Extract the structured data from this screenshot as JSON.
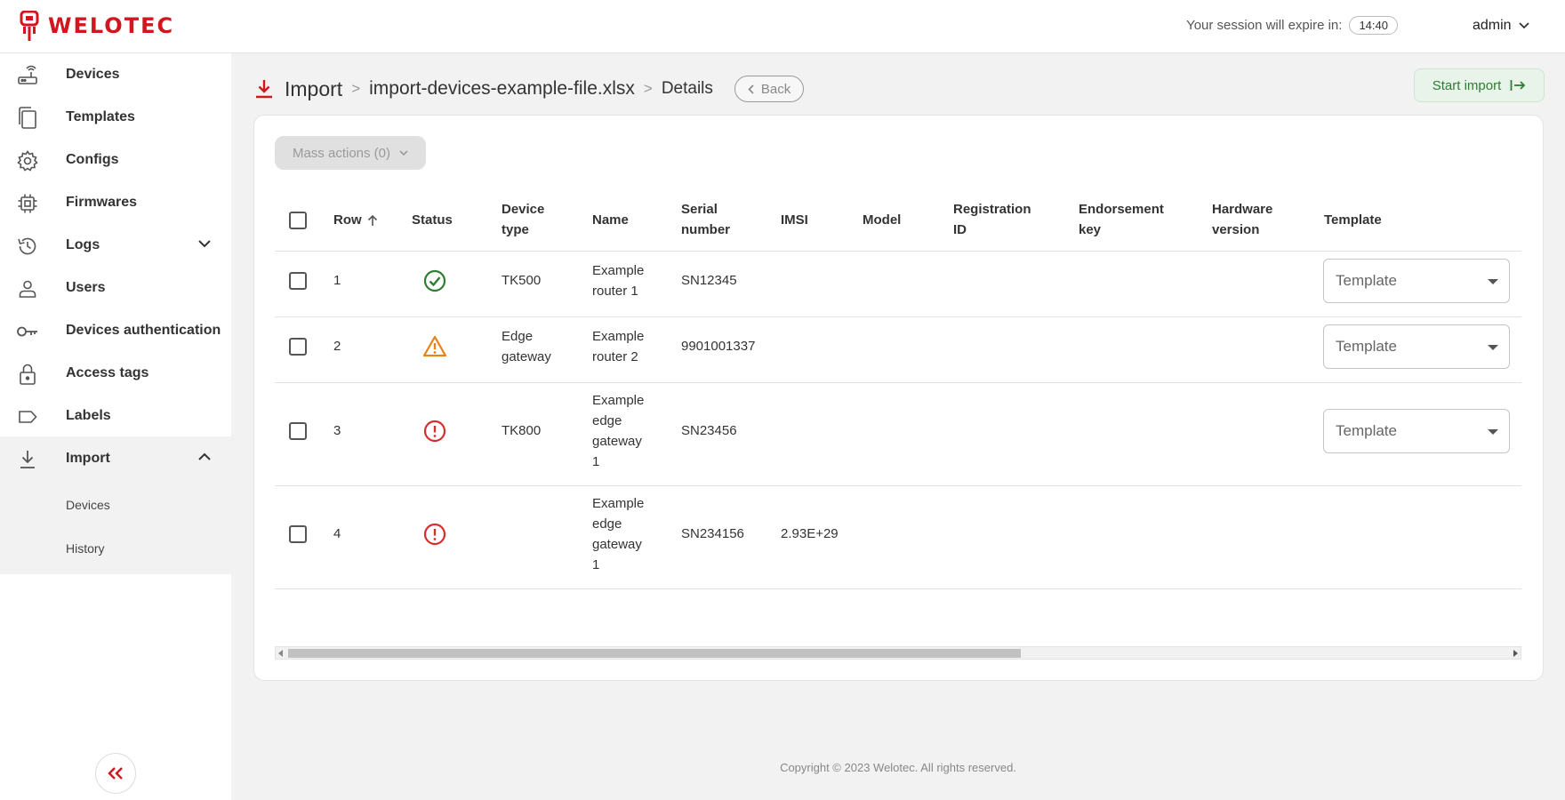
{
  "brand": {
    "name": "WELOTEC",
    "color": "#d0161f"
  },
  "header": {
    "session_label": "Your session will expire in:",
    "session_time": "14:40",
    "user": "admin"
  },
  "sidebar": {
    "items": [
      {
        "label": "Devices",
        "icon": "router-icon"
      },
      {
        "label": "Templates",
        "icon": "copy-icon"
      },
      {
        "label": "Configs",
        "icon": "gear-icon"
      },
      {
        "label": "Firmwares",
        "icon": "chip-icon"
      },
      {
        "label": "Logs",
        "icon": "history-icon"
      },
      {
        "label": "Users",
        "icon": "user-icon"
      },
      {
        "label": "Devices authentication",
        "icon": "key-icon"
      },
      {
        "label": "Access tags",
        "icon": "lock-icon"
      },
      {
        "label": "Labels",
        "icon": "label-icon"
      },
      {
        "label": "Import",
        "icon": "download-icon"
      }
    ],
    "import_sub": [
      "Devices",
      "History"
    ]
  },
  "page": {
    "title": "Import",
    "file": "import-devices-example-file.xlsx",
    "details": "Details",
    "back": "Back",
    "start_import": "Start import",
    "mass_actions": "Mass actions (0)"
  },
  "table": {
    "headers": {
      "row": "Row",
      "status": "Status",
      "device_type": [
        "Device",
        "type"
      ],
      "name": "Name",
      "serial": [
        "Serial",
        "number"
      ],
      "imsi": "IMSI",
      "model": "Model",
      "registration": [
        "Registration",
        "ID"
      ],
      "endorsement": [
        "Endorsement",
        "key"
      ],
      "hardware": [
        "Hardware",
        "version"
      ],
      "template": "Template"
    },
    "rows": [
      {
        "row": "1",
        "status": "success",
        "device_type": [
          "TK500"
        ],
        "name": [
          "Example",
          "router 1"
        ],
        "serial": "SN12345",
        "imsi": "",
        "template": "Template"
      },
      {
        "row": "2",
        "status": "warning",
        "device_type": [
          "Edge",
          "gateway"
        ],
        "name": [
          "Example",
          "router 2"
        ],
        "serial": "9901001337",
        "imsi": "",
        "template": "Template"
      },
      {
        "row": "3",
        "status": "error",
        "device_type": [
          "TK800"
        ],
        "name": [
          "Example",
          "edge",
          "gateway",
          "1"
        ],
        "serial": "SN23456",
        "imsi": "",
        "template": "Template"
      },
      {
        "row": "4",
        "status": "error",
        "device_type": [],
        "name": [
          "Example",
          "edge",
          "gateway",
          "1"
        ],
        "serial": "SN234156",
        "imsi": "2.93E+29",
        "template": ""
      }
    ]
  },
  "status_colors": {
    "success": "#2e7d32",
    "warning": "#e8821b",
    "error": "#d32f2f"
  },
  "footer": "Copyright © 2023 Welotec. All rights reserved."
}
